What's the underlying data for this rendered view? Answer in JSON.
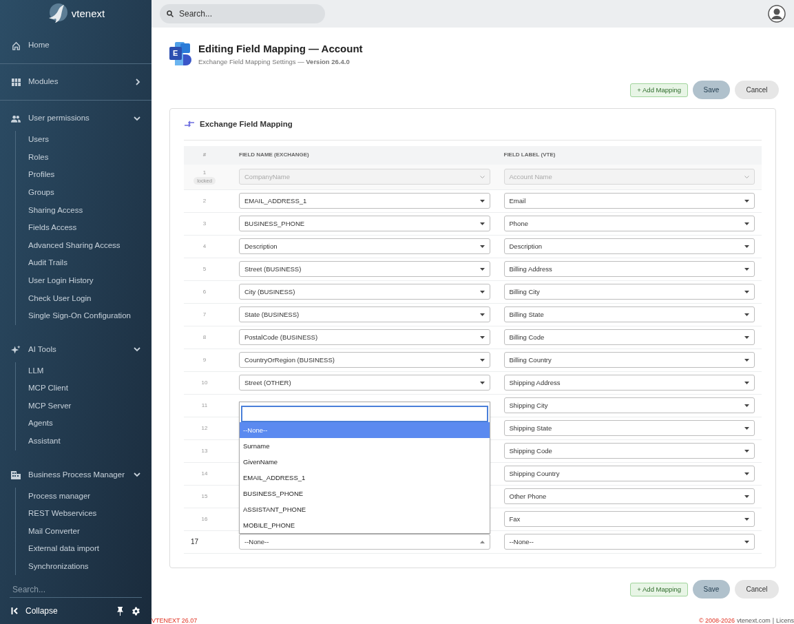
{
  "sidebar": {
    "logo_text": "vtenext",
    "items": [
      {
        "label": "Home"
      },
      {
        "label": "Modules",
        "expanded": false
      },
      {
        "label": "User permissions",
        "expanded": true,
        "children": [
          {
            "label": "Users"
          },
          {
            "label": "Roles"
          },
          {
            "label": "Profiles"
          },
          {
            "label": "Groups"
          },
          {
            "label": "Sharing Access"
          },
          {
            "label": "Fields Access"
          },
          {
            "label": "Advanced Sharing Access"
          },
          {
            "label": "Audit Trails"
          },
          {
            "label": "User Login History"
          },
          {
            "label": "Check User Login"
          },
          {
            "label": "Single Sign-On Configuration"
          }
        ]
      },
      {
        "label": "AI Tools",
        "expanded": true,
        "children": [
          {
            "label": "LLM"
          },
          {
            "label": "MCP Client"
          },
          {
            "label": "MCP Server"
          },
          {
            "label": "Agents"
          },
          {
            "label": "Assistant"
          }
        ]
      },
      {
        "label": "Business Process Manager",
        "expanded": true,
        "children": [
          {
            "label": "Process manager"
          },
          {
            "label": "REST Webservices"
          },
          {
            "label": "Mail Converter"
          },
          {
            "label": "External data import"
          },
          {
            "label": "Synchronizations"
          }
        ]
      }
    ],
    "search": {
      "placeholder": "Search..."
    },
    "collapse_label": "Collapse"
  },
  "topbar": {
    "search": {
      "placeholder": "Search..."
    }
  },
  "header": {
    "logo_letter": "E",
    "title": "Editing Field Mapping — Account",
    "subtitle": "Exchange Field Mapping Settings — **Version 26.4.0**"
  },
  "actions_top": {
    "add": "+ Add Mapping",
    "save": "Save",
    "cancel": "Cancel"
  },
  "card": {
    "title": "Exchange Field Mapping",
    "columns": [
      "#",
      "FIELD NAME (EXCHANGE)",
      "FIELD LABEL (VTE)"
    ],
    "rows": [
      {
        "number": "1",
        "badge": "locked",
        "disabled": true,
        "new": false,
        "open": false,
        "field_name": "CompanyName",
        "field_label": "Account Name"
      },
      {
        "number": "2",
        "disabled": false,
        "new": false,
        "open": false,
        "field_name": "EMAIL_ADDRESS_1",
        "field_label": "Email"
      },
      {
        "number": "3",
        "disabled": false,
        "new": false,
        "open": false,
        "field_name": "BUSINESS_PHONE",
        "field_label": "Phone"
      },
      {
        "number": "4",
        "disabled": false,
        "new": false,
        "open": false,
        "field_name": "Description",
        "field_label": "Description"
      },
      {
        "number": "5",
        "disabled": false,
        "new": false,
        "open": false,
        "field_name": "Street (BUSINESS)",
        "field_label": "Billing Address"
      },
      {
        "number": "6",
        "disabled": false,
        "new": false,
        "open": false,
        "field_name": "City (BUSINESS)",
        "field_label": "Billing City"
      },
      {
        "number": "7",
        "disabled": false,
        "new": false,
        "open": false,
        "field_name": "State (BUSINESS)",
        "field_label": "Billing State"
      },
      {
        "number": "8",
        "disabled": false,
        "new": false,
        "open": false,
        "field_name": "PostalCode (BUSINESS)",
        "field_label": "Billing Code"
      },
      {
        "number": "9",
        "disabled": false,
        "new": false,
        "open": false,
        "field_name": "CountryOrRegion (BUSINESS)",
        "field_label": "Billing Country"
      },
      {
        "number": "10",
        "disabled": false,
        "new": false,
        "open": false,
        "field_name": "Street (OTHER)",
        "field_label": "Shipping Address"
      },
      {
        "number": "11",
        "disabled": false,
        "new": false,
        "open": false,
        "field_label": "Shipping City"
      },
      {
        "number": "12",
        "disabled": false,
        "new": false,
        "open": false,
        "field_label": "Shipping State"
      },
      {
        "number": "13",
        "disabled": false,
        "new": false,
        "open": false,
        "field_label": "Shipping Code"
      },
      {
        "number": "14",
        "disabled": false,
        "new": false,
        "open": false,
        "field_label": "Shipping Country"
      },
      {
        "number": "15",
        "disabled": false,
        "new": false,
        "open": false,
        "field_label": "Other Phone"
      },
      {
        "number": "16",
        "disabled": false,
        "new": false,
        "open": false,
        "field_label": "Fax"
      },
      {
        "number": "17",
        "disabled": false,
        "new": true,
        "open": true,
        "field_name": "--None--",
        "field_label": "--None--"
      }
    ],
    "dropdown": {
      "options": [
        {
          "label": "--None--",
          "selected": true
        },
        {
          "label": "Surname",
          "selected": false
        },
        {
          "label": "GivenName",
          "selected": false
        },
        {
          "label": "EMAIL_ADDRESS_1",
          "selected": false
        },
        {
          "label": "BUSINESS_PHONE",
          "selected": false
        },
        {
          "label": "ASSISTANT_PHONE",
          "selected": false
        },
        {
          "label": "MOBILE_PHONE",
          "selected": false
        }
      ]
    }
  },
  "actions_bottom": {
    "add": "+ Add Mapping",
    "save": "Save",
    "cancel": "Cancel"
  },
  "footer": {
    "version": "VTENEXT 26.07",
    "copyright": "© 2008-2026",
    "site": "vtenext.com",
    "separator": "|",
    "license": "Licens"
  }
}
